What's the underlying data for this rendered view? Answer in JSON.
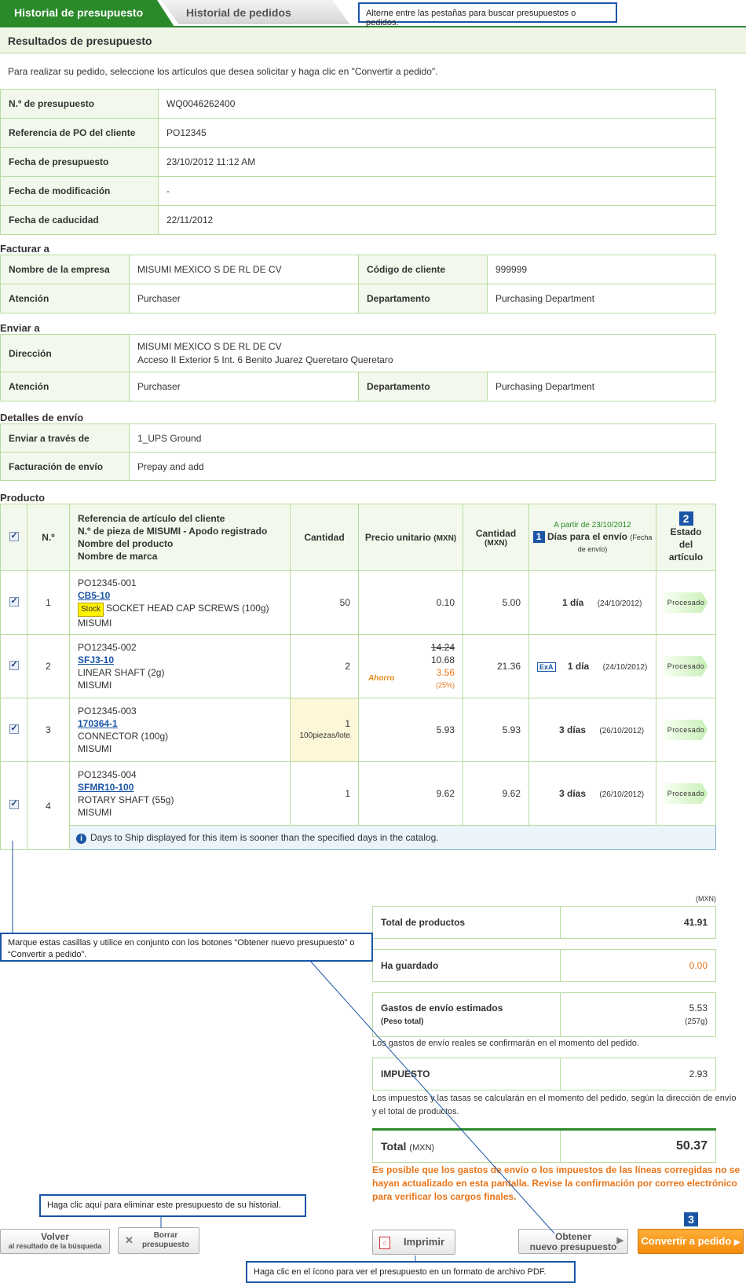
{
  "tabs": {
    "active": "Historial de presupuesto",
    "inactive": "Historial de pedidos"
  },
  "callouts": {
    "tabs_hint": "Alterne entre las pestañas para buscar presupuestos o pedidos.",
    "checkbox_hint": "Marque estas casillas y utilice en conjunto con los botones “Obtener nuevo presupuesto” o “Convertir a pedido”.",
    "delete_hint": "Haga clic aquí para eliminar este presupuesto de su historial.",
    "print_hint": "Haga clic en el ícono para ver el presupuesto en un formato de archivo PDF."
  },
  "results": {
    "title": "Resultados de presupuesto",
    "instruction": "Para realizar su pedido, seleccione los artículos que desea solicitar y haga clic en \"Convertir a pedido\"."
  },
  "quote_info": [
    {
      "label": "N.º de presupuesto",
      "value": "WQ0046262400"
    },
    {
      "label": "Referencia de PO del cliente",
      "value": "PO12345"
    },
    {
      "label": "Fecha de presupuesto",
      "value": "23/10/2012 11:12 AM"
    },
    {
      "label": "Fecha de modificación",
      "value": "-"
    },
    {
      "label": "Fecha de caducidad",
      "value": "22/11/2012"
    }
  ],
  "bill_to": {
    "title": "Facturar a",
    "company_label": "Nombre de la empresa",
    "company": "MISUMI MEXICO S DE RL DE CV",
    "customer_code_label": "Código de cliente",
    "customer_code": "999999",
    "attention_label": "Atención",
    "attention": "Purchaser",
    "department_label": "Departamento",
    "department": "Purchasing Department"
  },
  "ship_to": {
    "title": "Enviar a",
    "address_label": "Dirección",
    "address_line1": "MISUMI MEXICO S DE RL DE CV",
    "address_line2": "Acceso II Exterior 5 Int. 6 Benito Juarez Queretaro Queretaro",
    "attention_label": "Atención",
    "attention": "Purchaser",
    "department_label": "Departamento",
    "department": "Purchasing Department"
  },
  "shipping": {
    "title": "Detalles de envío",
    "via_label": "Enviar a través de",
    "via": "1_UPS Ground",
    "billing_label": "Facturación de envío",
    "billing": "Prepay and add"
  },
  "products": {
    "title": "Producto",
    "headers": {
      "no": "N.º",
      "ref_line1": "Referencia de artículo del cliente",
      "ref_line2": "N.º de pieza de MISUMI - Apodo registrado",
      "ref_line3": "Nombre del producto",
      "ref_line4": "Nombre de marca",
      "qty": "Cantidad",
      "unit_price": "Precio unitario",
      "unit_price_cur": "(MXN)",
      "amount": "Cantidad",
      "amount_cur": "(MXN)",
      "days_from": "A partir de 23/10/2012",
      "days_badge": "1",
      "days": "Días para el envío",
      "days_sub": "(Fecha de envío)",
      "status_badge": "2",
      "status": "Estado del artículo"
    },
    "rows": [
      {
        "no": "1",
        "ref": "PO12345-001",
        "code": "CB5-10",
        "stock": "Stock",
        "name": "SOCKET HEAD CAP SCREWS (100g)",
        "brand": "MISUMI",
        "qty": "50",
        "qty_note": "",
        "price": "0.10",
        "price_orig": "",
        "savings_label": "",
        "savings": "",
        "savings_pct": "",
        "amount": "5.00",
        "exa": "",
        "days": "1 día",
        "ship_date": "(24/10/2012)",
        "status": "Procesado"
      },
      {
        "no": "2",
        "ref": "PO12345-002",
        "code": "SFJ3-10",
        "stock": "",
        "name": "LINEAR SHAFT (2g)",
        "brand": "MISUMI",
        "qty": "2",
        "qty_note": "",
        "price": "10.68",
        "price_orig": "14.24",
        "savings_label": "Ahorro",
        "savings": "3.56",
        "savings_pct": "(25%)",
        "amount": "21.36",
        "exa": "ExA",
        "days": "1 día",
        "ship_date": "(24/10/2012)",
        "status": "Procesado"
      },
      {
        "no": "3",
        "ref": "PO12345-003",
        "code": "170364-1",
        "stock": "",
        "name": "CONNECTOR (100g)",
        "brand": "MISUMI",
        "qty": "1",
        "qty_note": "100piezas/lote",
        "price": "5.93",
        "price_orig": "",
        "savings_label": "",
        "savings": "",
        "savings_pct": "",
        "amount": "5.93",
        "exa": "",
        "days": "3 días",
        "ship_date": "(26/10/2012)",
        "status": "Procesado"
      },
      {
        "no": "4",
        "ref": "PO12345-004",
        "code": "SFMR10-100",
        "stock": "",
        "name": "ROTARY SHAFT (55g)",
        "brand": "MISUMI",
        "qty": "1",
        "qty_note": "",
        "price": "9.62",
        "price_orig": "",
        "savings_label": "",
        "savings": "",
        "savings_pct": "",
        "amount": "9.62",
        "exa": "",
        "days": "3 días",
        "ship_date": "(26/10/2012)",
        "status": "Procesado"
      }
    ],
    "info_note": "Days to Ship displayed for this item is sooner than the specified days in the catalog."
  },
  "totals": {
    "currency": "(MXN)",
    "products_label": "Total de productos",
    "products": "41.91",
    "saved_label": "Ha guardado",
    "saved": "0.00",
    "shipping_label": "Gastos de envío estimados",
    "shipping_sub": "(Peso total)",
    "shipping": "5.53",
    "weight": "(257g)",
    "shipping_note": "Los gastos de envío reales se confirmarán en el momento del pedido.",
    "tax_label": "IMPUESTO",
    "tax": "2.93",
    "tax_note": "Los impuestos y las tasas se calcularán en el momento del pedido, según la dirección de envío y el total de productos.",
    "total_label": "Total",
    "total_cur": "(MXN)",
    "total": "50.37",
    "warning": "Es posible que los gastos de envío o los impuestos de las líneas corregidas no se hayan actualizado en esta pantalla. Revise la confirmación por correo electrónico para verificar los cargos finales."
  },
  "buttons": {
    "back_line1": "Volver",
    "back_line2": "al resultado de la búsqueda",
    "delete_line1": "Borrar",
    "delete_line2": "presupuesto",
    "print": "Imprimir",
    "new_quote_line1": "Obtener",
    "new_quote_line2": "nuevo presupuesto",
    "convert_badge": "3",
    "convert": "Convertir a pedido"
  },
  "colors": {
    "accent": "#2a8a2a",
    "callout_border": "#1a55a6",
    "warning": "#e8751a",
    "convert": "#f48b0a"
  }
}
